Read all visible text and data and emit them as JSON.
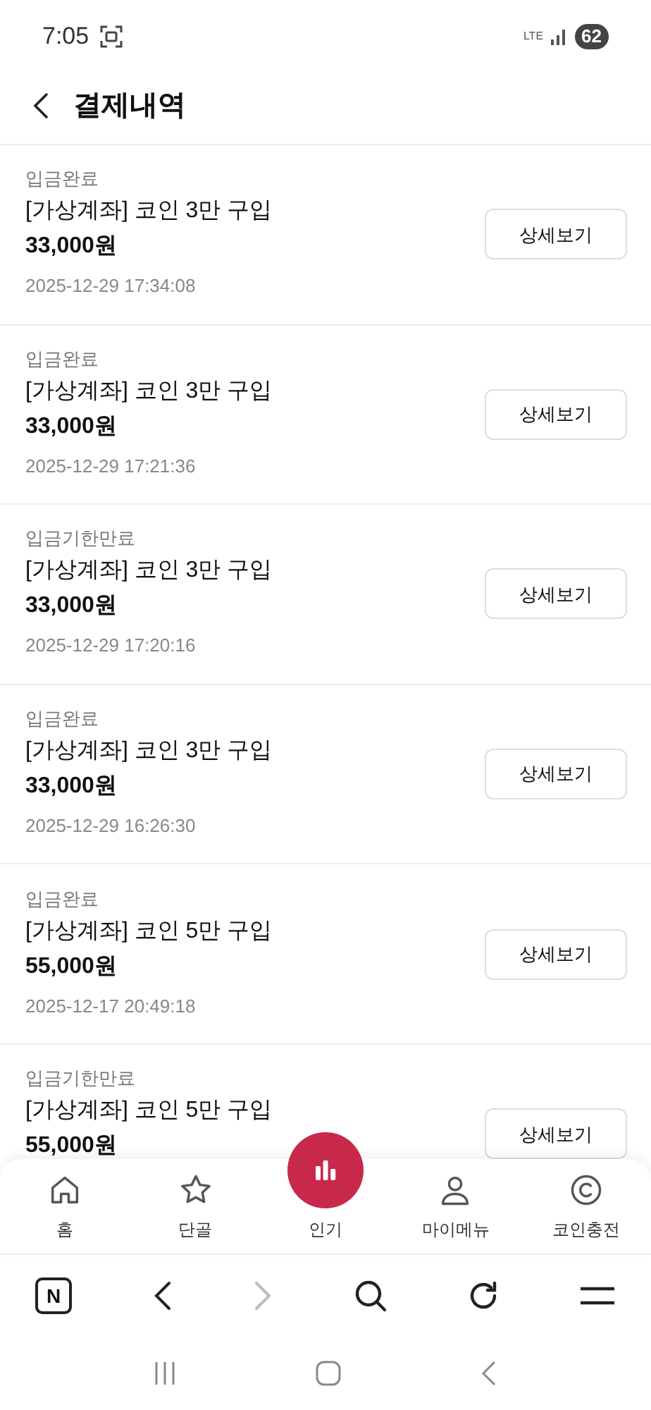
{
  "status_bar": {
    "time": "7:05",
    "network": "LTE",
    "battery": "62"
  },
  "header": {
    "title": "결제내역"
  },
  "payments": [
    {
      "status": "입금완료",
      "title": "[가상계좌] 코인 3만 구입",
      "amount": "33,000원",
      "date": "2025-12-29 17:34:08",
      "button": "상세보기"
    },
    {
      "status": "입금완료",
      "title": "[가상계좌] 코인 3만 구입",
      "amount": "33,000원",
      "date": "2025-12-29 17:21:36",
      "button": "상세보기"
    },
    {
      "status": "입금기한만료",
      "title": "[가상계좌] 코인 3만 구입",
      "amount": "33,000원",
      "date": "2025-12-29 17:20:16",
      "button": "상세보기"
    },
    {
      "status": "입금완료",
      "title": "[가상계좌] 코인 3만 구입",
      "amount": "33,000원",
      "date": "2025-12-29 16:26:30",
      "button": "상세보기"
    },
    {
      "status": "입금완료",
      "title": "[가상계좌] 코인 5만 구입",
      "amount": "55,000원",
      "date": "2025-12-17 20:49:18",
      "button": "상세보기"
    },
    {
      "status": "입금기한만료",
      "title": "[가상계좌] 코인 5만 구입",
      "amount": "55,000원",
      "button": "상세보기"
    }
  ],
  "bottom_nav": [
    {
      "kind": "home",
      "label": "홈",
      "selected": false
    },
    {
      "kind": "star",
      "label": "단골",
      "selected": false
    },
    {
      "kind": "chart",
      "label": "인기",
      "selected": true
    },
    {
      "kind": "person",
      "label": "마이메뉴",
      "selected": false
    },
    {
      "kind": "coin",
      "label": "코인충전",
      "selected": false
    }
  ],
  "browser_bar": {
    "logo": "N",
    "forward_disabled": true
  }
}
